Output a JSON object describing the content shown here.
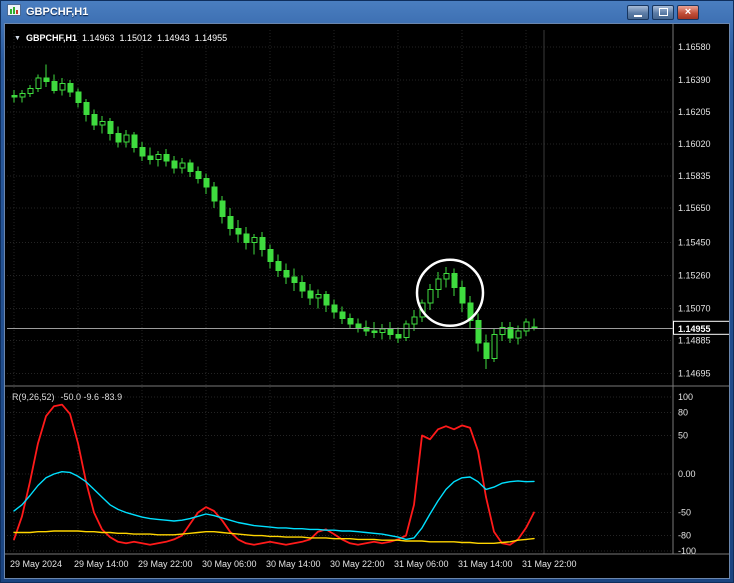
{
  "window": {
    "title": "GBPCHF,H1",
    "controls": {
      "close_glyph": "×"
    }
  },
  "chart_header": {
    "collapse_icon": "▼",
    "symbol": "GBPCHF,H1",
    "open": "1.14963",
    "high": "1.15012",
    "low": "1.14943",
    "close": "1.14955"
  },
  "indicator_header": {
    "name": "R(9,26,52)",
    "values": "-50.0 -9.6 -83.9"
  },
  "colors": {
    "background": "#000000",
    "candle": "#3fdc3f",
    "grid": "#242424",
    "separator": "#787878",
    "current_price_line": "#9c9c9c",
    "axis_text": "#e2e2e2",
    "red_line": "#ff1a1a",
    "cyan_line": "#00e0ff",
    "yellow_line": "#ffd500",
    "annotation": "#ffffff"
  },
  "chart_data": [
    {
      "type": "candlestick",
      "title": "GBPCHF,H1",
      "symbol": "GBPCHF",
      "timeframe": "H1",
      "y_range": [
        1.14633,
        1.16678
      ],
      "current_price": 1.14955,
      "current_price_label": "1.14955",
      "price_ticks": [
        {
          "value": 1.1658,
          "label": "1.16580"
        },
        {
          "value": 1.1639,
          "label": "1.16390"
        },
        {
          "value": 1.16205,
          "label": "1.16205"
        },
        {
          "value": 1.1602,
          "label": "1.16020"
        },
        {
          "value": 1.15835,
          "label": "1.15835"
        },
        {
          "value": 1.1565,
          "label": "1.15650"
        },
        {
          "value": 1.1545,
          "label": "1.15450"
        },
        {
          "value": 1.1526,
          "label": "1.15260"
        },
        {
          "value": 1.1507,
          "label": "1.15070"
        },
        {
          "value": 1.14885,
          "label": "1.14885"
        },
        {
          "value": 1.14695,
          "label": "1.14695"
        }
      ],
      "time_labels": [
        {
          "index": 0,
          "text": "29 May 2024"
        },
        {
          "index": 8,
          "text": "29 May 14:00"
        },
        {
          "index": 16,
          "text": "29 May 22:00"
        },
        {
          "index": 24,
          "text": "30 May 06:00"
        },
        {
          "index": 32,
          "text": "30 May 14:00"
        },
        {
          "index": 40,
          "text": "30 May 22:00"
        },
        {
          "index": 48,
          "text": "31 May 06:00"
        },
        {
          "index": 56,
          "text": "31 May 14:00"
        },
        {
          "index": 64,
          "text": "31 May 22:00"
        }
      ],
      "annotation_circle": {
        "index": 54.5,
        "price": 1.1516,
        "radius_px": 33
      },
      "candles_ohlc": [
        [
          1.163,
          1.1633,
          1.1626,
          1.1629
        ],
        [
          1.1629,
          1.1633,
          1.1626,
          1.1631
        ],
        [
          1.1631,
          1.1636,
          1.1629,
          1.1634
        ],
        [
          1.1634,
          1.1642,
          1.1632,
          1.164
        ],
        [
          1.164,
          1.1648,
          1.1635,
          1.1638
        ],
        [
          1.1638,
          1.1642,
          1.1631,
          1.1633
        ],
        [
          1.1633,
          1.164,
          1.163,
          1.1637
        ],
        [
          1.1637,
          1.1639,
          1.1629,
          1.1632
        ],
        [
          1.1632,
          1.1634,
          1.1623,
          1.1626
        ],
        [
          1.1626,
          1.1628,
          1.1615,
          1.1619
        ],
        [
          1.1619,
          1.1622,
          1.161,
          1.1613
        ],
        [
          1.1613,
          1.1618,
          1.1608,
          1.1615
        ],
        [
          1.1615,
          1.1617,
          1.1604,
          1.1608
        ],
        [
          1.1608,
          1.1612,
          1.16,
          1.1603
        ],
        [
          1.1603,
          1.161,
          1.16,
          1.1607
        ],
        [
          1.1607,
          1.1609,
          1.1597,
          1.16
        ],
        [
          1.16,
          1.1603,
          1.1592,
          1.1595
        ],
        [
          1.1595,
          1.16,
          1.159,
          1.1593
        ],
        [
          1.1593,
          1.1598,
          1.1589,
          1.1596
        ],
        [
          1.1596,
          1.1599,
          1.1589,
          1.1592
        ],
        [
          1.1592,
          1.1595,
          1.1585,
          1.1588
        ],
        [
          1.1588,
          1.1594,
          1.1585,
          1.1591
        ],
        [
          1.1591,
          1.1593,
          1.1583,
          1.1586
        ],
        [
          1.1586,
          1.1589,
          1.1579,
          1.1582
        ],
        [
          1.1582,
          1.1585,
          1.1573,
          1.1577
        ],
        [
          1.1577,
          1.158,
          1.1565,
          1.1569
        ],
        [
          1.1569,
          1.1572,
          1.1556,
          1.156
        ],
        [
          1.156,
          1.1565,
          1.1549,
          1.1553
        ],
        [
          1.1553,
          1.1558,
          1.1545,
          1.155
        ],
        [
          1.155,
          1.1554,
          1.1541,
          1.1545
        ],
        [
          1.1545,
          1.155,
          1.1538,
          1.1548
        ],
        [
          1.1548,
          1.1551,
          1.1537,
          1.1541
        ],
        [
          1.1541,
          1.1544,
          1.153,
          1.1534
        ],
        [
          1.1534,
          1.1538,
          1.1525,
          1.1529
        ],
        [
          1.1529,
          1.1533,
          1.1521,
          1.1525
        ],
        [
          1.1525,
          1.153,
          1.1517,
          1.1522
        ],
        [
          1.1522,
          1.1526,
          1.1513,
          1.1517
        ],
        [
          1.1517,
          1.1521,
          1.1509,
          1.1513
        ],
        [
          1.1513,
          1.1518,
          1.1507,
          1.1515
        ],
        [
          1.1515,
          1.1517,
          1.1505,
          1.1509
        ],
        [
          1.1509,
          1.1512,
          1.1501,
          1.1505
        ],
        [
          1.1505,
          1.1508,
          1.1498,
          1.1501
        ],
        [
          1.1501,
          1.1504,
          1.1495,
          1.1498
        ],
        [
          1.1498,
          1.1501,
          1.1493,
          1.1496
        ],
        [
          1.1496,
          1.15,
          1.1491,
          1.1494
        ],
        [
          1.1494,
          1.1499,
          1.149,
          1.1493
        ],
        [
          1.1493,
          1.1498,
          1.1489,
          1.1495
        ],
        [
          1.1495,
          1.1499,
          1.1489,
          1.1492
        ],
        [
          1.1492,
          1.1496,
          1.1487,
          1.149
        ],
        [
          1.149,
          1.15,
          1.1488,
          1.1498
        ],
        [
          1.1498,
          1.1506,
          1.1494,
          1.1502
        ],
        [
          1.1502,
          1.1512,
          1.1499,
          1.151
        ],
        [
          1.151,
          1.1521,
          1.1506,
          1.1518
        ],
        [
          1.1518,
          1.1528,
          1.1513,
          1.1524
        ],
        [
          1.1524,
          1.1531,
          1.1519,
          1.1527
        ],
        [
          1.1527,
          1.153,
          1.1514,
          1.1519
        ],
        [
          1.1519,
          1.1523,
          1.1505,
          1.151
        ],
        [
          1.151,
          1.1514,
          1.1495,
          1.15
        ],
        [
          1.15,
          1.1504,
          1.1482,
          1.1487
        ],
        [
          1.1487,
          1.1492,
          1.1472,
          1.1478
        ],
        [
          1.1478,
          1.1495,
          1.1476,
          1.1492
        ],
        [
          1.1492,
          1.1499,
          1.1488,
          1.1496
        ],
        [
          1.1496,
          1.1499,
          1.1487,
          1.149
        ],
        [
          1.149,
          1.1497,
          1.1486,
          1.1494
        ],
        [
          1.1494,
          1.1501,
          1.1491,
          1.1499
        ],
        [
          1.14963,
          1.15012,
          1.14943,
          1.14955
        ]
      ]
    },
    {
      "type": "line",
      "title": "R(9,26,52)",
      "last_values": [
        "-50.0",
        "-9.6",
        "-83.9"
      ],
      "y_range": [
        -101.3,
        110.3
      ],
      "ticks": [
        {
          "value": 100,
          "label": "100"
        },
        {
          "value": 80,
          "label": "80"
        },
        {
          "value": 50,
          "label": "50"
        },
        {
          "value": 0,
          "label": "0.00"
        },
        {
          "value": -50,
          "label": "-50"
        },
        {
          "value": -80,
          "label": "-80"
        },
        {
          "value": -100,
          "label": "-100"
        }
      ],
      "series": [
        {
          "name": "fast",
          "color": "#ff1a1a",
          "values": [
            -85,
            -55,
            -10,
            40,
            75,
            88,
            90,
            78,
            40,
            -10,
            -50,
            -72,
            -82,
            -88,
            -90,
            -88,
            -90,
            -92,
            -90,
            -88,
            -85,
            -80,
            -65,
            -50,
            -43,
            -48,
            -60,
            -75,
            -85,
            -90,
            -92,
            -90,
            -88,
            -90,
            -92,
            -90,
            -88,
            -85,
            -75,
            -72,
            -78,
            -85,
            -90,
            -92,
            -90,
            -88,
            -90,
            -88,
            -85,
            -80,
            -40,
            50,
            45,
            58,
            62,
            58,
            63,
            60,
            30,
            -30,
            -75,
            -90,
            -92,
            -85,
            -70,
            -50
          ]
        },
        {
          "name": "medium",
          "color": "#00e0ff",
          "values": [
            -48,
            -40,
            -28,
            -15,
            -5,
            0,
            3,
            2,
            -3,
            -10,
            -20,
            -30,
            -40,
            -46,
            -50,
            -53,
            -56,
            -58,
            -59,
            -60,
            -61,
            -60,
            -58,
            -55,
            -52,
            -54,
            -57,
            -60,
            -63,
            -65,
            -67,
            -68,
            -69,
            -70,
            -70,
            -71,
            -71,
            -72,
            -72,
            -73,
            -73,
            -74,
            -74,
            -75,
            -76,
            -77,
            -78,
            -80,
            -82,
            -85,
            -83,
            -70,
            -52,
            -35,
            -20,
            -10,
            -5,
            -4,
            -10,
            -20,
            -17,
            -12,
            -10,
            -9,
            -10,
            -9.6
          ]
        },
        {
          "name": "slow",
          "color": "#ffd500",
          "values": [
            -76,
            -76,
            -76,
            -75,
            -75,
            -74,
            -74,
            -74,
            -74,
            -75,
            -75,
            -76,
            -76,
            -77,
            -77,
            -78,
            -78,
            -78,
            -79,
            -79,
            -79,
            -78,
            -77,
            -76,
            -75,
            -75,
            -76,
            -77,
            -78,
            -79,
            -80,
            -80,
            -81,
            -81,
            -82,
            -82,
            -82,
            -83,
            -83,
            -83,
            -84,
            -84,
            -84,
            -85,
            -85,
            -85,
            -86,
            -86,
            -86,
            -87,
            -87,
            -87,
            -88,
            -88,
            -88,
            -88,
            -89,
            -89,
            -90,
            -90,
            -90,
            -89,
            -88,
            -86,
            -85,
            -83.9
          ]
        }
      ]
    }
  ]
}
